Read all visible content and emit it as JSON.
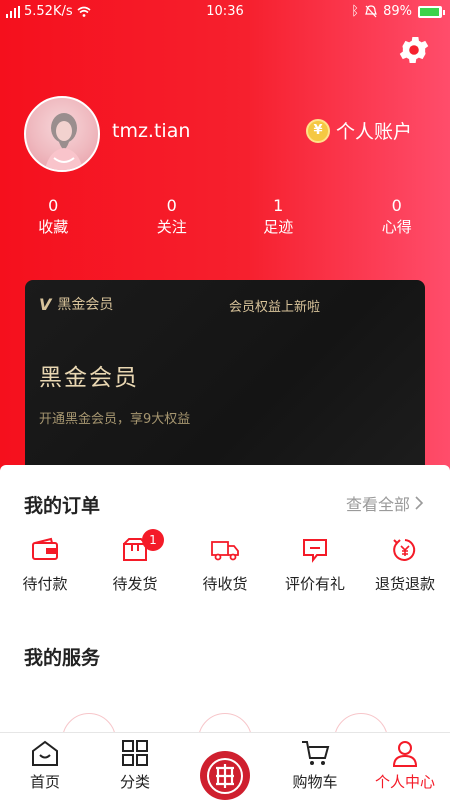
{
  "status_bar": {
    "network": "5.52K/s",
    "time": "10:36",
    "battery": "89%",
    "battery_level": 0.89
  },
  "header": {
    "settings_icon": "gear-icon",
    "username": "tmz.tian",
    "account_label": "个人账户",
    "coin_symbol": "¥"
  },
  "stats": [
    {
      "value": "0",
      "label": "收藏"
    },
    {
      "value": "0",
      "label": "关注"
    },
    {
      "value": "1",
      "label": "足迹"
    },
    {
      "value": "0",
      "label": "心得"
    }
  ],
  "vip_card": {
    "brand_mark": "V",
    "brand_label": "黑金会员",
    "news": "会员权益上新啦",
    "title": "黑金会员",
    "subtitle": "开通黑金会员，享9大权益"
  },
  "orders": {
    "title": "我的订单",
    "view_all": "查看全部",
    "items": [
      {
        "label": "待付款",
        "icon": "wallet-icon",
        "badge": ""
      },
      {
        "label": "待发货",
        "icon": "package-icon",
        "badge": "1"
      },
      {
        "label": "待收货",
        "icon": "truck-icon",
        "badge": ""
      },
      {
        "label": "评价有礼",
        "icon": "comment-icon",
        "badge": ""
      },
      {
        "label": "退货退款",
        "icon": "refund-icon",
        "badge": ""
      }
    ]
  },
  "services": {
    "title": "我的服务"
  },
  "tabbar": {
    "items": [
      {
        "label": "首页",
        "icon": "home-icon",
        "active": false
      },
      {
        "label": "分类",
        "icon": "grid-icon",
        "active": false
      },
      {
        "label": "",
        "icon": "brand-logo-icon",
        "active": false
      },
      {
        "label": "购物车",
        "icon": "cart-icon",
        "active": false
      },
      {
        "label": "个人中心",
        "icon": "user-icon",
        "active": true
      }
    ]
  },
  "colors": {
    "accent": "#f41b28",
    "vip_gold": "#d8c39a"
  }
}
